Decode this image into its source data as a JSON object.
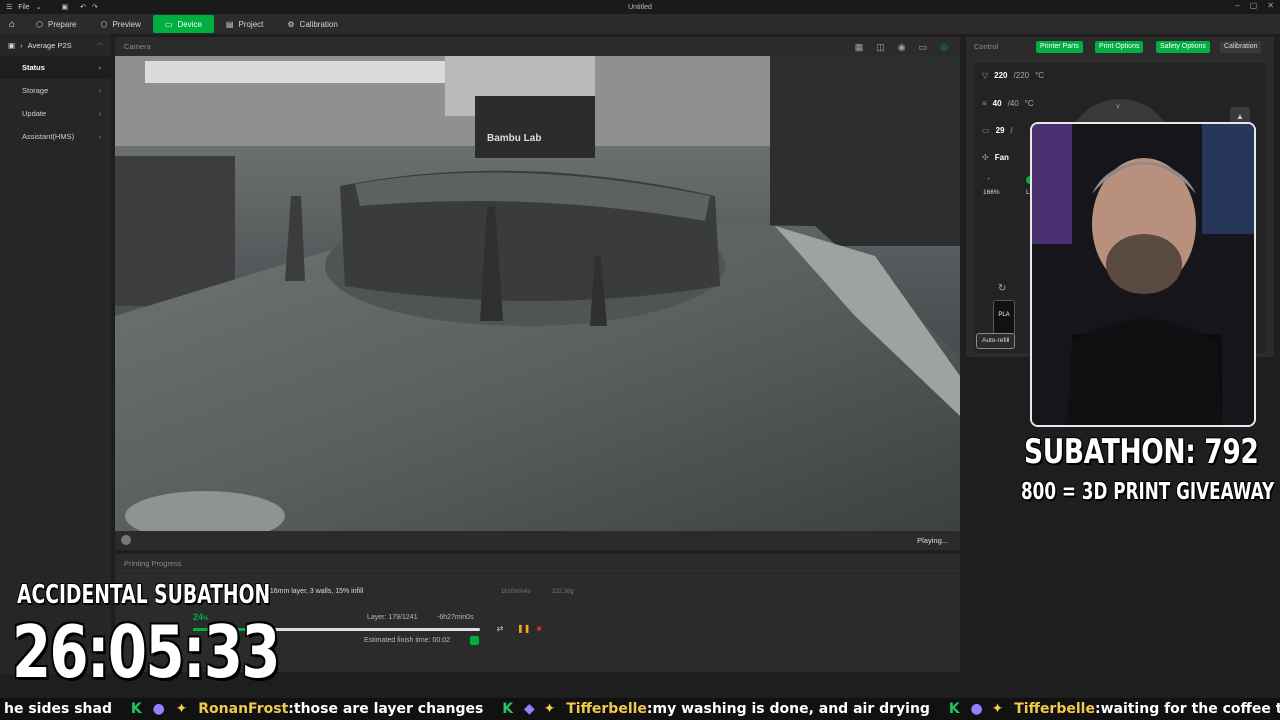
{
  "titlebar": {
    "menu": "File",
    "title": "Untitled"
  },
  "nav": {
    "tabs": [
      {
        "label": "Prepare",
        "icon": "prepare-icon"
      },
      {
        "label": "Preview",
        "icon": "preview-icon"
      },
      {
        "label": "Device",
        "icon": "device-icon",
        "active": true
      },
      {
        "label": "Project",
        "icon": "project-icon"
      },
      {
        "label": "Calibration",
        "icon": "calibration-icon"
      }
    ]
  },
  "sidebar": {
    "printer": "Average P2S",
    "items": [
      "Status",
      "Storage",
      "Update",
      "Assistant(HMS)"
    ]
  },
  "camera": {
    "title": "Camera",
    "status": "Playing...",
    "printer_label": "Bambu Lab"
  },
  "progress": {
    "title": "Printing Progress",
    "details": "0.16mm layer, 3 walls, 15% infill",
    "meta1": "1h10min4s",
    "meta2": "322.38g",
    "percent": "24",
    "percent_unit": "%",
    "fraction": 0.24,
    "layer": "Layer: 179/1241",
    "remaining": "-6h27min0s",
    "finish": "Estimated finish time: 00:02"
  },
  "control": {
    "title": "Control",
    "tabs": [
      "Printer Parts",
      "Print Options",
      "Safety Options",
      "Calibration"
    ],
    "nozzle": {
      "cur": "220",
      "tgt": "/220",
      "unit": "°C"
    },
    "bed": {
      "cur": "40",
      "tgt": "/40",
      "unit": "°C"
    },
    "chamber": {
      "cur": "29",
      "tgt": "/"
    },
    "fan_label": "Fan",
    "speed": "166%",
    "lamp": "La",
    "filament": "PLA",
    "auto_refill": "Auto-refill",
    "joystick_label": "Y"
  },
  "overlay": {
    "subathon": "SUBATHON: 792",
    "giveaway": "800 = 3D PRINT GIVEAWAY",
    "accidental": "ACCIDENTAL SUBATHON",
    "timer": "26:05:33"
  },
  "ticker": [
    {
      "user": "",
      "msg": "he sides shad"
    },
    {
      "user": "RonanFrost",
      "msg": "those are layer changes"
    },
    {
      "user": "Tifferbelle",
      "msg": "my washing is done, and air drying"
    },
    {
      "user": "Tifferbelle",
      "msg": "waiting for the coffee to brew my guy"
    }
  ]
}
